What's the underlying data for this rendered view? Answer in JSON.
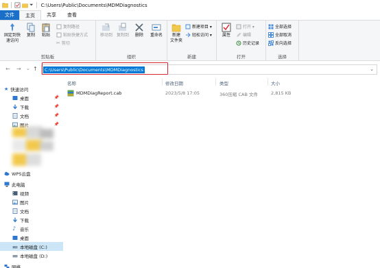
{
  "window": {
    "title": "C:\\Users\\Public\\Documents\\MDMDiagnostics"
  },
  "tabs": [
    {
      "label": "文件"
    },
    {
      "label": "主页"
    },
    {
      "label": "共享"
    },
    {
      "label": "查看"
    }
  ],
  "ribbon": {
    "clipboard": {
      "pin_label": "固定到快\n速访问",
      "copy_label": "复制",
      "paste_label": "粘贴",
      "copy_path": "复制路径",
      "paste_shortcut": "粘贴快捷方式",
      "cut": "剪切",
      "group_label": "剪贴板"
    },
    "organize": {
      "move_to": "移动到",
      "copy_to": "复制到",
      "delete": "删除",
      "rename": "重命名",
      "group_label": "组织"
    },
    "new": {
      "new_folder": "新建\n文件夹",
      "new_item": "新建项目 ▾",
      "easy_access": "轻松访问 ▾",
      "group_label": "新建"
    },
    "open": {
      "properties": "属性",
      "open": "打开 ▾",
      "edit": "编辑",
      "history": "历史记录",
      "group_label": "打开"
    },
    "select": {
      "select_all": "全部选择",
      "select_none": "全部取消",
      "invert": "反向选择",
      "group_label": "选择"
    }
  },
  "address": {
    "path": "C:\\Users\\Public\\Documents\\MDMDiagnostics",
    "back": "←",
    "forward": "→",
    "recent": "⌄",
    "up": "↑",
    "dropdown": "⌄"
  },
  "nav_pane": {
    "quick_access": "快速访问",
    "quick_items": [
      {
        "label": "桌面",
        "pinned": true
      },
      {
        "label": "下载",
        "pinned": true
      },
      {
        "label": "文档",
        "pinned": true
      },
      {
        "label": "图片",
        "pinned": true
      }
    ],
    "wps": "WPS云盘",
    "this_pc": "此电脑",
    "pc_items": [
      {
        "label": "视频"
      },
      {
        "label": "图片"
      },
      {
        "label": "文档"
      },
      {
        "label": "下载"
      },
      {
        "label": "音乐"
      },
      {
        "label": "桌面"
      },
      {
        "label": "本地磁盘 (C:)"
      },
      {
        "label": "本地磁盘 (D:)"
      }
    ],
    "network": "网络"
  },
  "file_list": {
    "columns": [
      "名称",
      "修改日期",
      "类型",
      "大小"
    ],
    "rows": [
      {
        "name": "MDMDiagReport.cab",
        "modified": "2023/5/8 17:05",
        "type": "360压缩 CAB 文件",
        "size": "2,815 KB"
      }
    ]
  }
}
